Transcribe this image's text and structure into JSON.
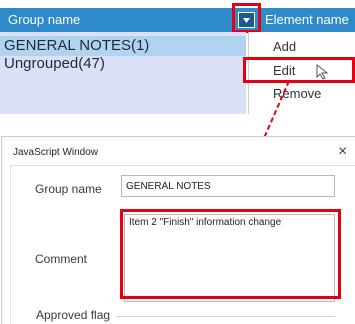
{
  "top_panel": {
    "group_header": "Group name",
    "element_header": "Element name",
    "groups": [
      "GENERAL NOTES(1)",
      "Ungrouped(47)"
    ],
    "context_menu": [
      "Add",
      "Edit",
      "Remove"
    ]
  },
  "dialog": {
    "title": "JavaScript Window",
    "close_glyph": "×",
    "fields": {
      "group_name_label": "Group name",
      "group_name_value": "GENERAL NOTES",
      "comment_label": "Comment",
      "comment_value": "Item 2 \"Finish\" information change",
      "approved_flag_label": "Approved flag"
    }
  },
  "colors": {
    "header_blue": "#2e8ac9",
    "selection_blue": "#b0d3f0",
    "list_background": "#dbe0f6",
    "highlight_red": "#e60012"
  },
  "icons": [
    "dropdown-arrow-icon",
    "mouse-cursor-icon",
    "close-icon"
  ]
}
